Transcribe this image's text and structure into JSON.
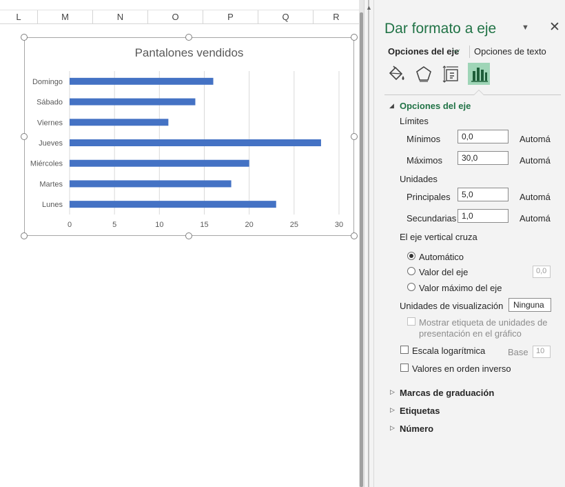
{
  "sheet": {
    "columns": [
      "L",
      "M",
      "N",
      "O",
      "P",
      "Q",
      "R"
    ]
  },
  "chart": {
    "title": "Pantalones vendidos"
  },
  "chart_data": {
    "type": "bar",
    "orientation": "horizontal",
    "title": "Pantalones vendidos",
    "categories": [
      "Lunes",
      "Martes",
      "Miércoles",
      "Jueves",
      "Viernes",
      "Sábado",
      "Domingo"
    ],
    "values": [
      23,
      18,
      20,
      28,
      11,
      14,
      16
    ],
    "xlim": [
      0,
      30
    ],
    "xticks": [
      0,
      5,
      10,
      15,
      20,
      25,
      30
    ],
    "grid": true,
    "bar_color": "#4472c4",
    "xlabel": "",
    "ylabel": ""
  },
  "pane": {
    "title": "Dar formato a eje",
    "menu_icon": "chevron-down-icon",
    "close_icon": "close-icon",
    "tab_axis_options": "Opciones del eje",
    "tab_text_options": "Opciones de texto",
    "accent_color": "#217346",
    "icons": [
      "paint-bucket-icon",
      "pentagon-icon",
      "size-properties-icon",
      "bar-chart-icon"
    ],
    "axis_options": {
      "heading": "Opciones del eje",
      "limits_label": "Límites",
      "minimum_label": "Mínimos",
      "minimum_value": "0,0",
      "minimum_auto": "Automá",
      "maximum_label": "Máximos",
      "maximum_value": "30,0",
      "maximum_auto": "Automá",
      "units_label": "Unidades",
      "major_label": "Principales",
      "major_value": "5,0",
      "major_auto": "Automá",
      "minor_label": "Secundarias",
      "minor_value": "1,0",
      "minor_auto": "Automá",
      "crosses_label": "El eje vertical cruza",
      "radio_automatic": "Automático",
      "radio_axis_value": "Valor del eje",
      "axis_value_input": "0,0",
      "radio_max_value": "Valor máximo del eje",
      "display_units_label": "Unidades de visualización",
      "display_units_value": "Ninguna",
      "show_units_label_line1": "Mostrar etiqueta de unidades de",
      "show_units_label_line2": "presentación en el gráfico",
      "log_scale_label": "Escala logarítmica",
      "base_label": "Base",
      "base_value": "10",
      "reverse_order_label": "Valores en orden inverso"
    },
    "sections": {
      "tick_marks": "Marcas de graduación",
      "labels": "Etiquetas",
      "number": "Número"
    }
  }
}
